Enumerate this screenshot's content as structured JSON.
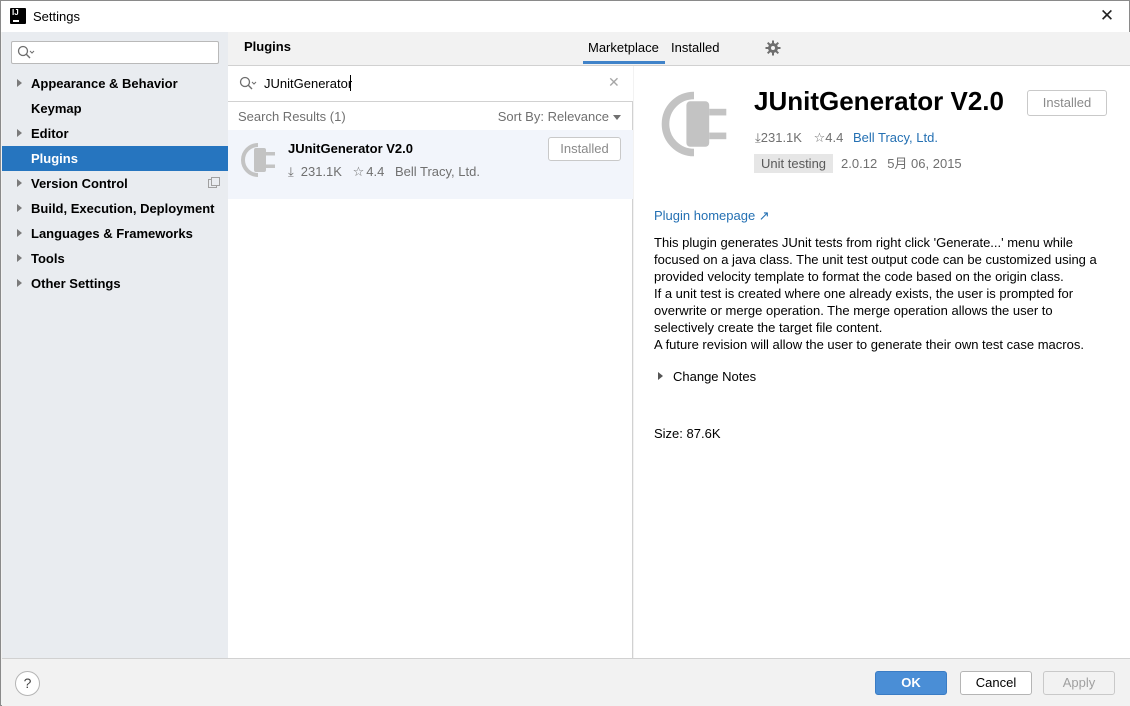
{
  "window": {
    "title": "Settings",
    "app_logo_text": "IJ"
  },
  "sidebar": {
    "search_placeholder": "",
    "items": [
      {
        "label": "Appearance & Behavior",
        "expandable": true
      },
      {
        "label": "Keymap",
        "expandable": false
      },
      {
        "label": "Editor",
        "expandable": true
      },
      {
        "label": "Plugins",
        "expandable": false,
        "active": true
      },
      {
        "label": "Version Control",
        "expandable": true
      },
      {
        "label": "Build, Execution, Deployment",
        "expandable": true
      },
      {
        "label": "Languages & Frameworks",
        "expandable": true
      },
      {
        "label": "Tools",
        "expandable": true
      },
      {
        "label": "Other Settings",
        "expandable": true
      }
    ]
  },
  "header": {
    "title": "Plugins",
    "tabs": [
      {
        "label": "Marketplace",
        "selected": true
      },
      {
        "label": "Installed",
        "selected": false
      }
    ]
  },
  "list": {
    "search_value": "JUnitGenerator",
    "results_label": "Search Results (1)",
    "sort_label": "Sort By: Relevance",
    "plugins": [
      {
        "name": "JUnitGenerator V2.0",
        "downloads": "231.1K",
        "rating": "4.4",
        "vendor": "Bell Tracy, Ltd.",
        "button": "Installed"
      }
    ]
  },
  "detail": {
    "name": "JUnitGenerator V2.0",
    "button": "Installed",
    "downloads": "231.1K",
    "rating": "4.4",
    "vendor": "Bell Tracy, Ltd.",
    "tag": "Unit testing",
    "version": "2.0.12",
    "date": "5月 06, 2015",
    "homepage_label": "Plugin homepage ↗",
    "description": [
      "This plugin generates JUnit tests from right click 'Generate...' menu while focused on a java class. The unit test output code can be customized using a provided velocity template to format the code based on the origin class.",
      "If a unit test is created where one already exists, the user is prompted for overwrite or merge operation. The merge operation allows the user to selectively create the target file content.",
      "A future revision will allow the user to generate their own test case macros."
    ],
    "change_notes_label": "Change Notes",
    "size_label": "Size: 87.6K"
  },
  "footer": {
    "help_label": "?",
    "ok_label": "OK",
    "cancel_label": "Cancel",
    "apply_label": "Apply"
  },
  "colors": {
    "accent": "#2675bf",
    "link": "#2470b3",
    "sidebar_bg": "#e9ecf0",
    "selected_row_bg": "#f2f5fb"
  }
}
